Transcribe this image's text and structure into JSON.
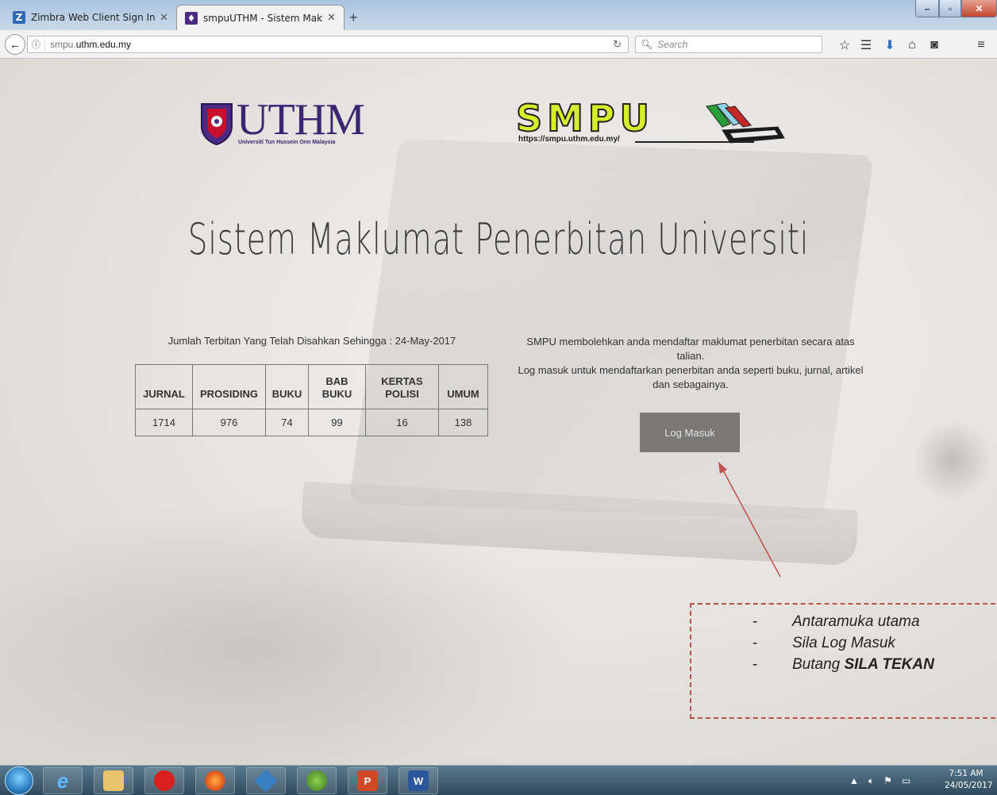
{
  "browser": {
    "tabs": [
      {
        "label": "Zimbra Web Client Sign In",
        "icon": "zimbra-icon",
        "active": false
      },
      {
        "label": "smpuUTHM - Sistem Maklum",
        "icon": "uthm-shield-icon",
        "active": true
      }
    ],
    "url_prefix": "smpu.",
    "url_domain": "uthm.edu.my",
    "search_placeholder": "Search"
  },
  "page": {
    "uthm_logo_text": "UTHM",
    "uthm_logo_subtitle": "Universiti Tun Hussein Onn Malaysia",
    "smpu_logo_text": "SMPU",
    "smpu_logo_url": "https://smpu.uthm.edu.my/",
    "title": "Sistem Maklumat Penerbitan Universiti",
    "stats_caption": "Jumlah Terbitan Yang Telah Disahkan Sehingga : 24-May-2017",
    "stats": {
      "headers": [
        "JURNAL",
        "PROSIDING",
        "BUKU",
        "BAB BUKU",
        "KERTAS POLISI",
        "UMUM"
      ],
      "values": [
        "1714",
        "976",
        "74",
        "99",
        "16",
        "138"
      ]
    },
    "intro_line1": "SMPU membolehkan anda mendaftar maklumat penerbitan secara atas talian.",
    "intro_line2": "Log masuk untuk mendaftarkan penerbitan anda seperti buku, jurnal, artikel dan sebagainya.",
    "login_label": "Log Masuk"
  },
  "annotation": {
    "items": [
      "Antaramuka utama",
      "Sila Log Masuk"
    ],
    "last_prefix": "Butang ",
    "last_bold": "SILA TEKAN",
    "dash": "-",
    "color": "#c0504d"
  },
  "taskbar": {
    "apps": [
      "internet-explorer-icon",
      "file-explorer-icon",
      "opera-icon",
      "firefox-icon",
      "virtualbox-icon",
      "game-icon",
      "powerpoint-icon",
      "word-icon"
    ],
    "time": "7:51 AM",
    "date": "24/05/2017"
  }
}
